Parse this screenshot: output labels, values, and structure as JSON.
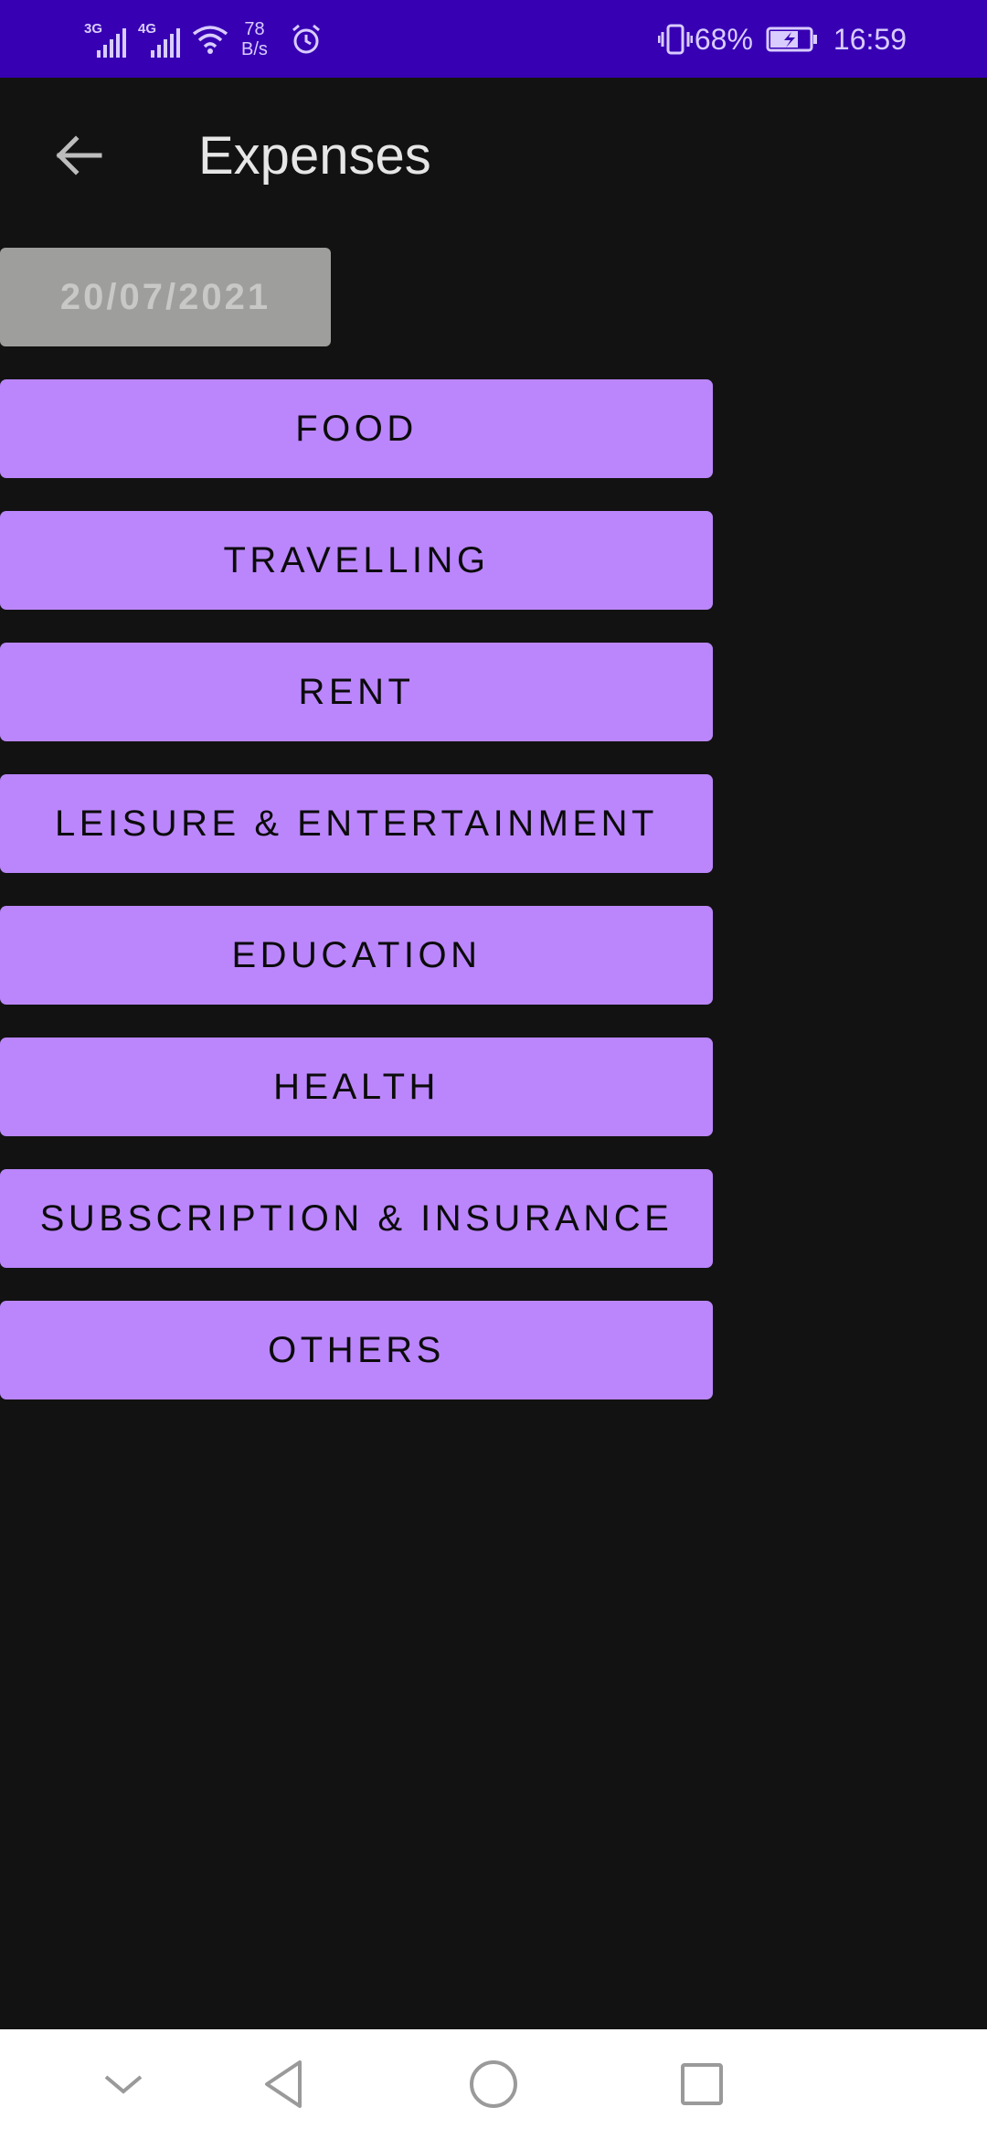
{
  "status_bar": {
    "network_1": "3G",
    "network_2": "4G",
    "speed_value": "78",
    "speed_unit": "B/s",
    "battery_percent": "68%",
    "time": "16:59",
    "icons": [
      "signal-icon",
      "wifi-icon",
      "alarm-icon",
      "vibrate-icon",
      "battery-charging-icon"
    ]
  },
  "app_bar": {
    "title": "Expenses",
    "back_icon": "arrow-back-icon"
  },
  "date_button": {
    "label": "20/07/2021"
  },
  "categories": [
    {
      "label": "FOOD"
    },
    {
      "label": "TRAVELLING"
    },
    {
      "label": "RENT"
    },
    {
      "label": "LEISURE & ENTERTAINMENT"
    },
    {
      "label": "EDUCATION"
    },
    {
      "label": "HEALTH"
    },
    {
      "label": "SUBSCRIPTION & INSURANCE"
    },
    {
      "label": "OTHERS"
    }
  ],
  "nav_bar": {
    "icons": [
      "chevron-down-icon",
      "back-triangle-icon",
      "home-circle-icon",
      "recents-square-icon"
    ]
  },
  "colors": {
    "status_bar": "#3700b3",
    "background": "#121212",
    "category_button": "#bb86fc",
    "date_button": "#9e9e9c"
  }
}
